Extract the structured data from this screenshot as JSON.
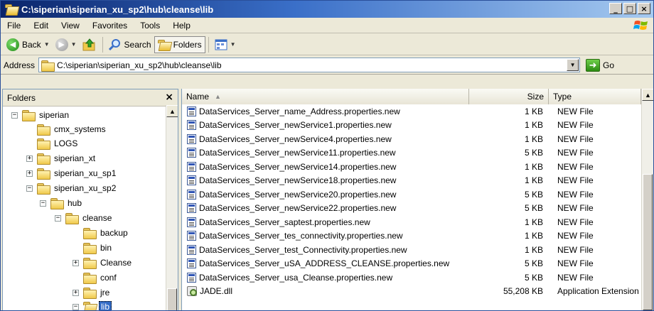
{
  "window": {
    "title": "C:\\siperian\\siperian_xu_sp2\\hub\\cleanse\\lib",
    "buttons": {
      "minimize": "_",
      "maximize": "□",
      "close": "×"
    }
  },
  "menu": [
    "File",
    "Edit",
    "View",
    "Favorites",
    "Tools",
    "Help"
  ],
  "toolbar": {
    "back": "Back",
    "search": "Search",
    "folders": "Folders"
  },
  "address": {
    "label": "Address",
    "value": "C:\\siperian\\siperian_xu_sp2\\hub\\cleanse\\lib",
    "go": "Go"
  },
  "folders_pane": {
    "title": "Folders",
    "close": "×",
    "tree": [
      {
        "label": "siperian",
        "expander": "−",
        "level": 0
      },
      {
        "label": "cmx_systems",
        "expander": "",
        "level": 1
      },
      {
        "label": "LOGS",
        "expander": "",
        "level": 1
      },
      {
        "label": "siperian_xt",
        "expander": "+",
        "level": 1
      },
      {
        "label": "siperian_xu_sp1",
        "expander": "+",
        "level": 1
      },
      {
        "label": "siperian_xu_sp2",
        "expander": "−",
        "level": 1
      },
      {
        "label": "hub",
        "expander": "−",
        "level": 2
      },
      {
        "label": "cleanse",
        "expander": "−",
        "level": 3
      },
      {
        "label": "backup",
        "expander": "",
        "level": 4
      },
      {
        "label": "bin",
        "expander": "",
        "level": 4
      },
      {
        "label": "Cleanse",
        "expander": "+",
        "level": 4
      },
      {
        "label": "conf",
        "expander": "",
        "level": 4
      },
      {
        "label": "jre",
        "expander": "+",
        "level": 4
      },
      {
        "label": "lib",
        "expander": "−",
        "level": 4,
        "selected": true
      }
    ]
  },
  "file_list": {
    "columns": {
      "name": "Name",
      "size": "Size",
      "type": "Type"
    },
    "rows": [
      {
        "name": "DataServices_Server_name_Address.properties.new",
        "size": "1 KB",
        "type": "NEW File",
        "icon": "file-icon"
      },
      {
        "name": "DataServices_Server_newService1.properties.new",
        "size": "1 KB",
        "type": "NEW File",
        "icon": "file-icon"
      },
      {
        "name": "DataServices_Server_newService4.properties.new",
        "size": "1 KB",
        "type": "NEW File",
        "icon": "file-icon"
      },
      {
        "name": "DataServices_Server_newService11.properties.new",
        "size": "5 KB",
        "type": "NEW File",
        "icon": "file-icon"
      },
      {
        "name": "DataServices_Server_newService14.properties.new",
        "size": "1 KB",
        "type": "NEW File",
        "icon": "file-icon"
      },
      {
        "name": "DataServices_Server_newService18.properties.new",
        "size": "1 KB",
        "type": "NEW File",
        "icon": "file-icon"
      },
      {
        "name": "DataServices_Server_newService20.properties.new",
        "size": "5 KB",
        "type": "NEW File",
        "icon": "file-icon"
      },
      {
        "name": "DataServices_Server_newService22.properties.new",
        "size": "5 KB",
        "type": "NEW File",
        "icon": "file-icon"
      },
      {
        "name": "DataServices_Server_saptest.properties.new",
        "size": "1 KB",
        "type": "NEW File",
        "icon": "file-icon"
      },
      {
        "name": "DataServices_Server_tes_connectivity.properties.new",
        "size": "1 KB",
        "type": "NEW File",
        "icon": "file-icon"
      },
      {
        "name": "DataServices_Server_test_Connectivity.properties.new",
        "size": "1 KB",
        "type": "NEW File",
        "icon": "file-icon"
      },
      {
        "name": "DataServices_Server_uSA_ADDRESS_CLEANSE.properties.new",
        "size": "5 KB",
        "type": "NEW File",
        "icon": "file-icon"
      },
      {
        "name": "DataServices_Server_usa_Cleanse.properties.new",
        "size": "5 KB",
        "type": "NEW File",
        "icon": "file-icon"
      },
      {
        "name": "JADE.dll",
        "size": "55,208 KB",
        "type": "Application Extension",
        "icon": "dll-icon"
      }
    ]
  },
  "colors": {
    "title_start": "#0a246a",
    "title_end": "#a6caf0",
    "selection": "#316ac5",
    "chrome": "#ece9d8"
  }
}
